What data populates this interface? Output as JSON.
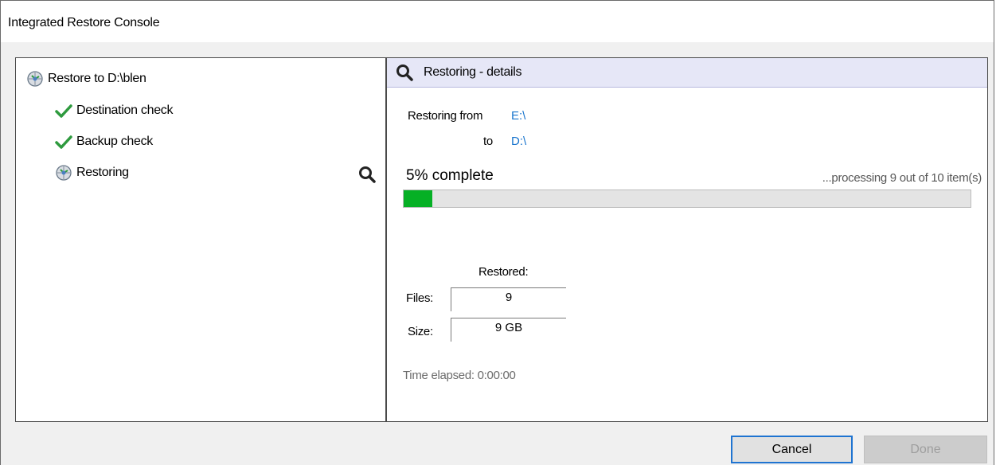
{
  "window": {
    "title": "Integrated Restore Console"
  },
  "tree": {
    "items": [
      {
        "label": "Restore to D:\\blen",
        "icon": "restore-gear-icon"
      },
      {
        "label": "Destination check",
        "icon": "checkmark-icon"
      },
      {
        "label": "Backup check",
        "icon": "checkmark-icon"
      },
      {
        "label": "Restoring",
        "icon": "restore-gear-icon"
      }
    ],
    "details_icon": "magnifier-icon"
  },
  "details": {
    "header": "Restoring - details",
    "from_label": "Restoring from",
    "from_value": "E:\\",
    "to_label": "to",
    "to_value": "D:\\",
    "percent_text": "5% complete",
    "progress_fraction": 0.05,
    "processing_text": "...processing 9 out of 10  item(s)",
    "restored_label": "Restored:",
    "files_label": "Files:",
    "files_value": "9",
    "size_label": "Size:",
    "size_value": "9 GB",
    "elapsed_text": "Time elapsed: 0:00:00"
  },
  "buttons": {
    "cancel": "Cancel",
    "done": "Done"
  },
  "colors": {
    "progress": "#06b025",
    "check": "#2e9a3e",
    "link": "#1874cd",
    "header_bg": "#e6e7f7",
    "focus_border": "#1f74d1"
  }
}
